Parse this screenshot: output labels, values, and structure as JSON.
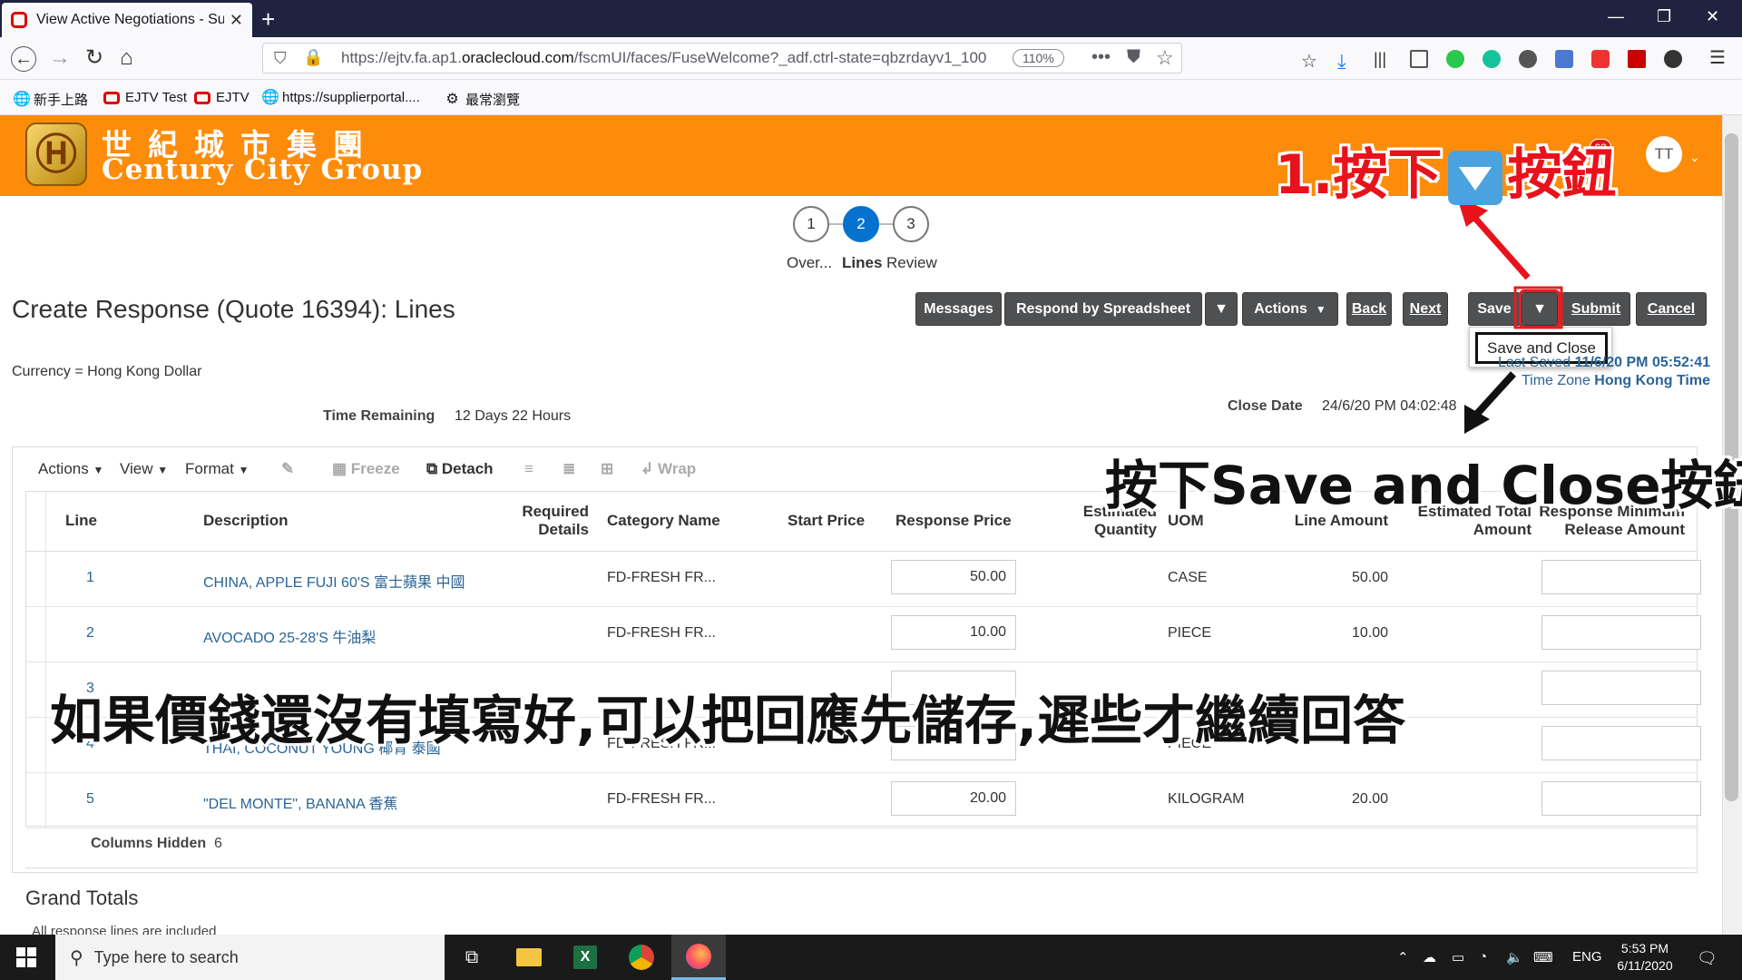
{
  "browser": {
    "tab_title": "View Active Negotiations - Sup",
    "url_prefix": "https://ejtv.fa.ap1.",
    "url_domain": "oraclecloud.com",
    "url_rest": "/fscmUI/faces/FuseWelcome?_adf.ctrl-state=qbzrdayv1_100",
    "zoom": "110%",
    "bookmarks": [
      "新手上路",
      "EJTV Test",
      "EJTV",
      "https://supplierportal....",
      "最常瀏覽"
    ]
  },
  "header": {
    "logo_cn": "世紀城市集團",
    "logo_en": "Century City Group",
    "notifications": "62",
    "avatar": "TT"
  },
  "train": {
    "steps": [
      {
        "num": "1",
        "label": "Over..."
      },
      {
        "num": "2",
        "label": "Lines"
      },
      {
        "num": "3",
        "label": "Review"
      }
    ]
  },
  "page": {
    "title": "Create Response (Quote 16394): Lines",
    "currency": "Currency = Hong Kong Dollar",
    "last_saved_label": "Last Saved",
    "last_saved_value": "11/6/20 PM 05:52:41",
    "tz_label": "Time Zone",
    "tz_value": "Hong Kong Time",
    "time_remaining_label": "Time Remaining",
    "time_remaining_value": "12 Days 22 Hours",
    "close_date_label": "Close Date",
    "close_date_value": "24/6/20 PM 04:02:48"
  },
  "toolbar": {
    "messages": "Messages",
    "respond": "Respond by Spreadsheet",
    "actions": "Actions",
    "back": "Back",
    "next": "Next",
    "save": "Save",
    "submit": "Submit",
    "cancel": "Cancel",
    "save_and_close": "Save and Close"
  },
  "table_toolbar": {
    "actions": "Actions",
    "view": "View",
    "format": "Format",
    "freeze": "Freeze",
    "detach": "Detach",
    "wrap": "Wrap"
  },
  "table": {
    "headers": {
      "line": "Line",
      "description": "Description",
      "required1": "Required",
      "required2": "Details",
      "category": "Category Name",
      "start_price": "Start Price",
      "response_price": "Response Price",
      "est_qty1": "Estimated",
      "est_qty2": "Quantity",
      "uom": "UOM",
      "line_amount": "Line Amount",
      "est_total1": "Estimated Total",
      "est_total2": "Amount",
      "rmra1": "Response Minimum",
      "rmra2": "Release Amount"
    },
    "rows": [
      {
        "line": "1",
        "desc": "CHINA, APPLE FUJI 60'S 富士蘋果 中國",
        "category": "FD-FRESH FR...",
        "price": "50.00",
        "uom": "CASE",
        "amount": "50.00"
      },
      {
        "line": "2",
        "desc": "AVOCADO 25-28'S 牛油梨",
        "category": "FD-FRESH FR...",
        "price": "10.00",
        "uom": "PIECE",
        "amount": "10.00"
      },
      {
        "line": "3",
        "desc": "",
        "category": "",
        "price": "",
        "uom": "",
        "amount": ""
      },
      {
        "line": "4",
        "desc": "THAI, COCONUT YOUNG 椰青 泰國",
        "category": "FD-FRESH FR...",
        "price": "",
        "uom": "PIECE",
        "amount": ""
      },
      {
        "line": "5",
        "desc": "\"DEL MONTE\", BANANA 香蕉",
        "category": "FD-FRESH FR...",
        "price": "20.00",
        "uom": "KILOGRAM",
        "amount": "20.00"
      }
    ],
    "columns_hidden_label": "Columns Hidden",
    "columns_hidden_value": "6"
  },
  "grand_totals": {
    "title": "Grand Totals",
    "note": "All response lines are included"
  },
  "annotations": {
    "step1_a": "1.按下",
    "step1_b": "按鈕",
    "step2": "按下Save and Close按鈕",
    "caption": "如果價錢還沒有填寫好,可以把回應先儲存,遲些才繼續回答"
  },
  "taskbar": {
    "search_placeholder": "Type here to search",
    "lang": "ENG",
    "time": "5:53 PM",
    "date": "6/11/2020"
  }
}
